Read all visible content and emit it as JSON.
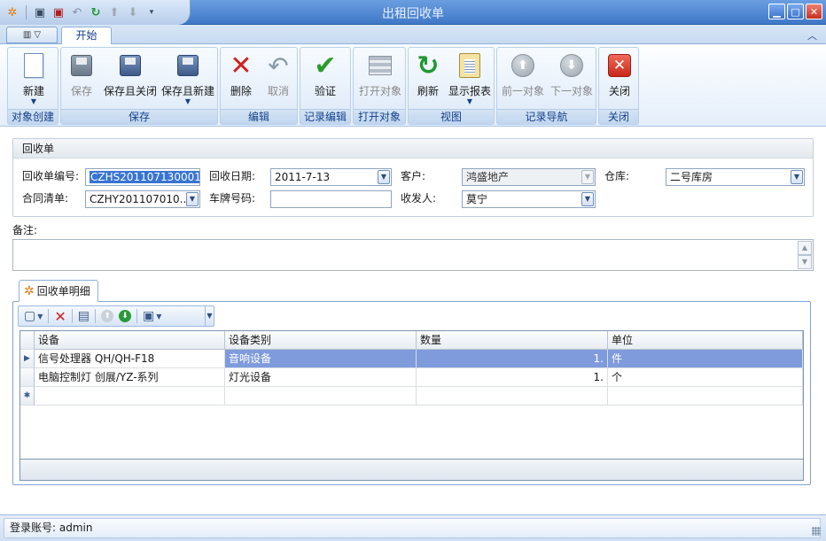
{
  "window": {
    "title": "出租回收单"
  },
  "tabs": {
    "start": "开始"
  },
  "ribbon": {
    "groups": {
      "create": "对象创建",
      "save": "保存",
      "edit": "编辑",
      "record_edit": "记录编辑",
      "open_object": "打开对象",
      "view": "视图",
      "record_nav": "记录导航",
      "close": "关闭"
    },
    "buttons": {
      "new": "新建",
      "save": "保存",
      "save_close": "保存且关闭",
      "save_new": "保存且新建",
      "delete": "删除",
      "cancel": "取消",
      "verify": "验证",
      "open_object": "打开对象",
      "refresh": "刷新",
      "show_report": "显示报表",
      "prev_object": "前一对象",
      "next_object": "下一对象",
      "close": "关闭"
    }
  },
  "form": {
    "title": "回收单",
    "receipt_no_label": "回收单编号:",
    "receipt_no": "CZHS201107130001",
    "date_label": "回收日期:",
    "date": "2011-7-13",
    "customer_label": "客户:",
    "customer": "鸿盛地产",
    "warehouse_label": "仓库:",
    "warehouse": "二号库房",
    "contract_label": "合同清单:",
    "contract": "CZHY201107010...",
    "plate_label": "车牌号码:",
    "plate": "",
    "handler_label": "收发人:",
    "handler": "莫宁",
    "remark_label": "备注:",
    "remark": ""
  },
  "detail": {
    "tab_label": "回收单明细",
    "columns": [
      "设备",
      "设备类别",
      "数量",
      "单位"
    ],
    "rows": [
      {
        "device": "信号处理器 QH/QH-F18",
        "category": "音响设备",
        "qty": "1.",
        "unit": "件"
      },
      {
        "device": "电脑控制灯 创展/YZ-系列",
        "category": "灯光设备",
        "qty": "1.",
        "unit": "个"
      }
    ]
  },
  "status": {
    "login": "登录账号: admin"
  }
}
